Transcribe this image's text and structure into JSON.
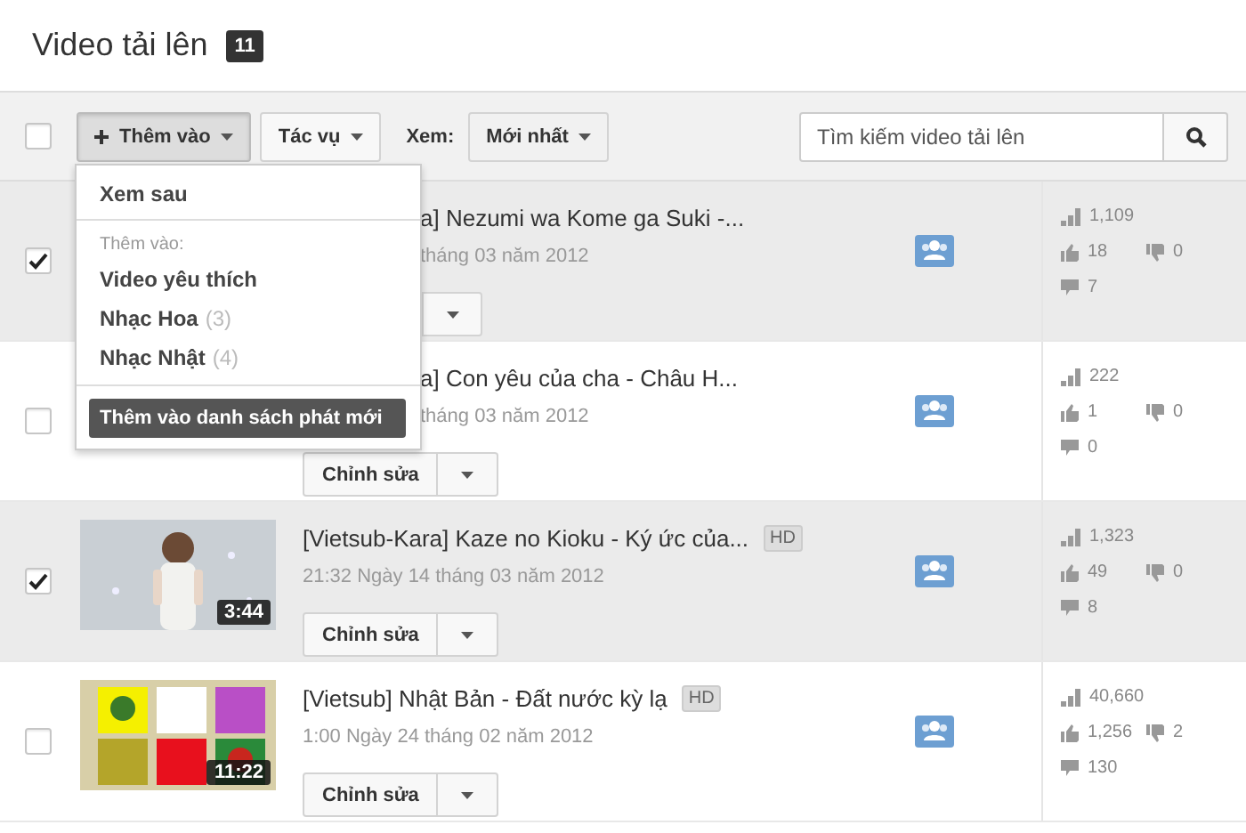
{
  "header": {
    "title": "Video tải lên",
    "count": "11"
  },
  "toolbar": {
    "select_all": {
      "checked": false
    },
    "add_button": {
      "label": "Thêm vào",
      "pressed": true
    },
    "actions_button": {
      "label": "Tác vụ"
    },
    "view_label": "Xem:",
    "sort_button": {
      "label": "Mới nhất"
    },
    "search": {
      "placeholder": "Tìm kiếm video tải lên"
    }
  },
  "add_menu": {
    "watch_later": "Xem sau",
    "section_label": "Thêm vào:",
    "playlists": [
      {
        "label": "Video yêu thích"
      },
      {
        "label": "Nhạc Hoa",
        "count": "(3)"
      },
      {
        "label": "Nhạc Nhật",
        "count": "(4)"
      }
    ],
    "new_playlist_button": "Thêm vào danh sách phát mới"
  },
  "videos": [
    {
      "checked": true,
      "title": "a] Nezumi wa Kome ga Suki -...",
      "hd": false,
      "date": "tháng 03 năm 2012",
      "stats": {
        "views": "1,109",
        "likes": "18",
        "dislikes": "0",
        "comments": "7"
      }
    },
    {
      "checked": false,
      "title": "a] Con yêu của cha - Châu H...",
      "hd": false,
      "date": "tháng 03 năm 2012",
      "edit_label": "Chỉnh sửa",
      "stats": {
        "views": "222",
        "likes": "1",
        "dislikes": "0",
        "comments": "0"
      }
    },
    {
      "checked": true,
      "title": "[Vietsub-Kara] Kaze no Kioku - Ký ức của...",
      "hd": true,
      "hd_label": "HD",
      "date": "21:32 Ngày 14 tháng 03 năm 2012",
      "edit_label": "Chỉnh sửa",
      "thumbnail": {
        "kind": "picture",
        "duration": "3:44"
      },
      "stats": {
        "views": "1,323",
        "likes": "49",
        "dislikes": "0",
        "comments": "8"
      }
    },
    {
      "checked": false,
      "title": "[Vietsub] Nhật Bản - Đất nước kỳ lạ",
      "hd": true,
      "hd_label": "HD",
      "date": "1:00 Ngày 24 tháng 02 năm 2012",
      "edit_label": "Chỉnh sửa",
      "thumbnail": {
        "kind": "picture",
        "duration": "11:22"
      },
      "stats": {
        "views": "40,660",
        "likes": "1,256",
        "dislikes": "2",
        "comments": "130"
      }
    }
  ]
}
